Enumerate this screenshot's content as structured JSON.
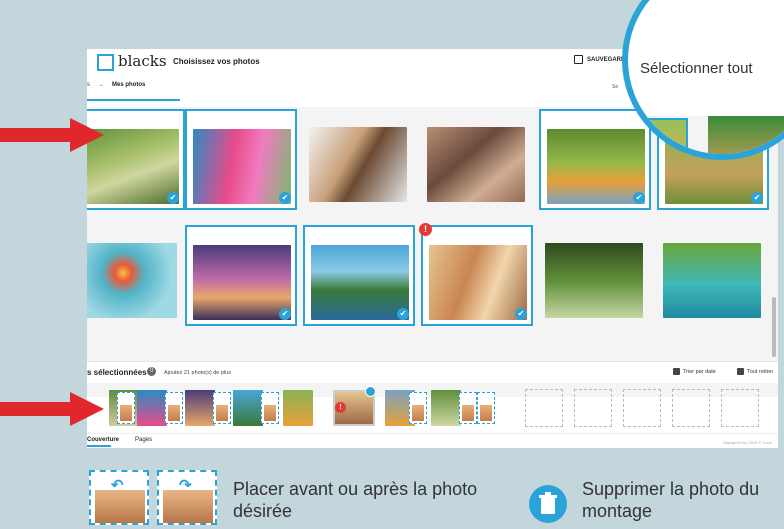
{
  "app": {
    "logo": "blacks",
    "title": "Choisissez vos photos",
    "save_label": "SAUVEGARDER",
    "breadcrumb_prev": "s",
    "breadcrumb_current": "Mes photos",
    "select_right": "Se"
  },
  "magnifier": {
    "select_all": "Sélectionner tout",
    "icons": "x  ◯"
  },
  "grid": {
    "tiles": [
      {
        "selected": true,
        "warning": false
      },
      {
        "selected": true,
        "warning": false
      },
      {
        "selected": false,
        "warning": false
      },
      {
        "selected": false,
        "warning": false
      },
      {
        "selected": true,
        "warning": false
      },
      {
        "selected": true,
        "warning": false
      },
      {
        "selected": false,
        "warning": false
      },
      {
        "selected": true,
        "warning": false
      },
      {
        "selected": true,
        "warning": false
      },
      {
        "selected": true,
        "warning": true
      },
      {
        "selected": false,
        "warning": false
      },
      {
        "selected": false,
        "warning": false
      }
    ]
  },
  "strip": {
    "title": "s sélectionnées",
    "count": "0",
    "more": "Ajoutez 21 photo(s) de plus",
    "sort_label": "Trier par date",
    "remove_label": "Tout retirer",
    "warn_glyph": "!"
  },
  "tabs": {
    "cover": "Couverture",
    "pages": "Pages"
  },
  "copyright": "Blackprint Inc 2019 © Corel",
  "legend": {
    "place_text": "Placer avant ou après la photo désirée",
    "delete_text": "Supprimer la photo du montage"
  },
  "colors": {
    "accent": "#2aa3d8",
    "arrow": "#e0272b",
    "warning": "#e53935",
    "background": "#c3d6dc"
  }
}
